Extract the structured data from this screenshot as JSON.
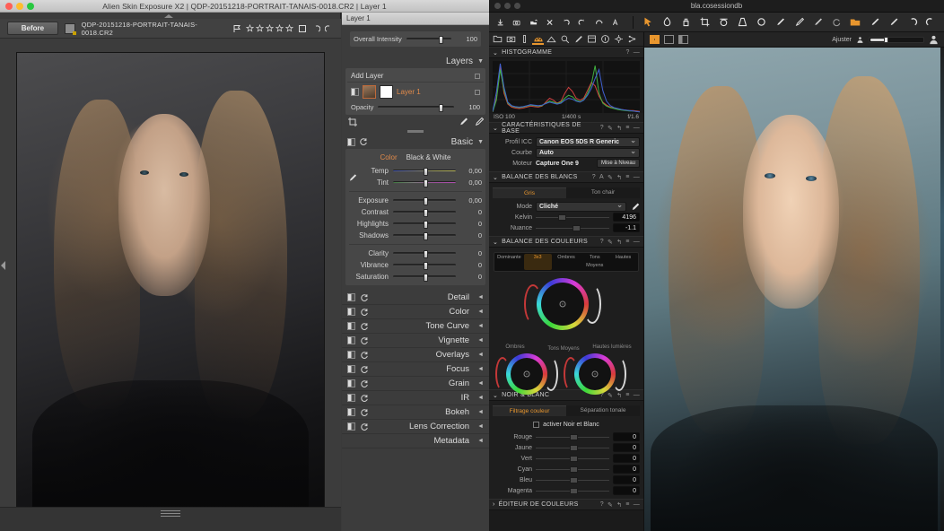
{
  "exposure": {
    "window_title": "Alien Skin Exposure X2 | QDP-20151218-PORTRAIT-TANAIS-0018.CR2 | Layer 1",
    "layer_tab": "Layer 1",
    "toolbar": {
      "before_label": "Before",
      "filename": "QDP-20151218-PORTRAIT-TANAIS-0018.CR2",
      "flag_icon": "flag-icon",
      "rating_stars": 5,
      "crop_icon": "square-icon",
      "undo_icon": "undo-icon",
      "redo_icon": "redo-icon"
    },
    "overall": {
      "label": "Overall Intensity",
      "value": "100"
    },
    "layers": {
      "title": "Layers",
      "add_layer": "Add Layer",
      "layer_name": "Layer 1",
      "opacity_label": "Opacity",
      "opacity_value": "100",
      "crop_tool_icon": "crop-icon",
      "brush_icon": "brush-icon",
      "eraser_icon": "eraser-icon"
    },
    "basic": {
      "title": "Basic",
      "mode_color": "Color",
      "mode_bw": "Black & White",
      "eyedropper_icon": "eyedropper-icon",
      "sliders": [
        {
          "label": "Temp",
          "value": "0,00",
          "knob": 50,
          "grad": "temp"
        },
        {
          "label": "Tint",
          "value": "0,00",
          "knob": 50,
          "grad": "tint"
        },
        {
          "label": "Exposure",
          "value": "0,00",
          "knob": 50,
          "grad": ""
        },
        {
          "label": "Contrast",
          "value": "0",
          "knob": 50,
          "grad": ""
        },
        {
          "label": "Highlights",
          "value": "0",
          "knob": 50,
          "grad": ""
        },
        {
          "label": "Shadows",
          "value": "0",
          "knob": 50,
          "grad": ""
        },
        {
          "label": "Clarity",
          "value": "0",
          "knob": 50,
          "grad": ""
        },
        {
          "label": "Vibrance",
          "value": "0",
          "knob": 50,
          "grad": ""
        },
        {
          "label": "Saturation",
          "value": "0",
          "knob": 50,
          "grad": ""
        }
      ]
    },
    "panels": [
      "Detail",
      "Color",
      "Tone Curve",
      "Vignette",
      "Overlays",
      "Focus",
      "Grain",
      "IR",
      "Bokeh",
      "Lens Correction",
      "Metadata"
    ]
  },
  "captureone": {
    "window_title": "bla.cosessiondb",
    "toolbar_icons": [
      "import-icon",
      "camera-icon",
      "export-icon",
      "delete-icon",
      "rotate-left-icon",
      "rotate-right-icon",
      "redo-icon",
      "annotate-icon"
    ],
    "tool_tabs": [
      "library-icon",
      "capture-icon",
      "lens-icon",
      "color-icon",
      "exposure-icon",
      "details-icon",
      "adjustments-icon",
      "metadata-icon",
      "output-icon",
      "settings-icon",
      "batch-icon"
    ],
    "active_tool_tab": 3,
    "histogram": {
      "title": "HISTOGRAMME",
      "iso": "ISO 100",
      "shutter": "1/400 s",
      "aperture": "f/1.6"
    },
    "base_characteristics": {
      "title": "CARACTÉRISTIQUES DE BASE",
      "rows": [
        {
          "label": "Profil ICC",
          "value": "Canon EOS 5DS R Generic"
        },
        {
          "label": "Courbe",
          "value": "Auto"
        }
      ],
      "engine_label": "Moteur",
      "engine_value": "Capture One 9",
      "upgrade_button": "Mise à Niveau"
    },
    "white_balance": {
      "title": "BALANCE DES BLANCS",
      "tabs": [
        "Gris",
        "Ton chair"
      ],
      "active_tab": 0,
      "mode_label": "Mode",
      "mode_value": "Cliché",
      "picker_icon": "eyedropper-icon",
      "sliders": [
        {
          "label": "Kelvin",
          "value": "4196",
          "knob": 32
        },
        {
          "label": "Nuance",
          "value": "-1.1",
          "knob": 52
        }
      ]
    },
    "color_balance": {
      "title": "BALANCE DES COULEURS",
      "tabs": [
        "Dominante",
        "3x3",
        "Ombres",
        "Tons Moyens",
        "Hautes"
      ],
      "active_tab": 1,
      "wheel_labels": [
        "Ombres",
        "Tons Moyens",
        "Hautes lumières"
      ]
    },
    "black_white": {
      "title": "NOIR & BLANC",
      "tabs": [
        "Filtrage couleur",
        "Séparation tonale"
      ],
      "active_tab": 0,
      "checkbox_label": "activer Noir et Blanc",
      "checked": false,
      "sliders": [
        {
          "label": "Rouge",
          "value": "0"
        },
        {
          "label": "Jaune",
          "value": "0"
        },
        {
          "label": "Vert",
          "value": "0"
        },
        {
          "label": "Cyan",
          "value": "0"
        },
        {
          "label": "Bleu",
          "value": "0"
        },
        {
          "label": "Magenta",
          "value": "0"
        }
      ]
    },
    "color_editor": {
      "title": "ÉDITEUR DE COULEURS"
    },
    "viewer": {
      "grid_icon": "grid-view-icon",
      "single_icon": "single-view-icon",
      "split_icon": "split-view-icon",
      "fit_label": "Ajuster",
      "small_icon": "small-thumb-icon",
      "large_icon": "large-thumb-icon"
    }
  },
  "colors": {
    "accent_orange": "#e8962e",
    "layer_orange": "#e08a4a",
    "panel_gray": "#3c3c3c",
    "c1_dark": "#1e1e1e"
  },
  "chart_data": {
    "type": "area",
    "title": "HISTOGRAMME",
    "xlabel": "",
    "ylabel": "",
    "series": [
      {
        "name": "red",
        "values": [
          2,
          30,
          95,
          40,
          18,
          12,
          10,
          9,
          10,
          12,
          14,
          13,
          12,
          14,
          22,
          30,
          26,
          20,
          24,
          40,
          52,
          44,
          30,
          26,
          30,
          46,
          62,
          55,
          34,
          22,
          16,
          12,
          10,
          8,
          7,
          6,
          5,
          5,
          4,
          3
        ]
      },
      {
        "name": "green",
        "values": [
          2,
          26,
          88,
          46,
          20,
          14,
          12,
          11,
          12,
          14,
          16,
          15,
          14,
          15,
          20,
          24,
          22,
          19,
          22,
          30,
          36,
          33,
          26,
          23,
          27,
          40,
          58,
          96,
          40,
          20,
          14,
          11,
          9,
          7,
          6,
          5,
          4,
          4,
          3,
          2
        ]
      },
      {
        "name": "blue",
        "values": [
          3,
          42,
          100,
          52,
          22,
          15,
          13,
          12,
          13,
          15,
          17,
          16,
          15,
          16,
          19,
          22,
          20,
          18,
          20,
          26,
          30,
          28,
          24,
          22,
          26,
          36,
          50,
          70,
          88,
          46,
          24,
          15,
          11,
          9,
          7,
          6,
          5,
          4,
          3,
          2
        ]
      }
    ],
    "ylim": [
      0,
      100
    ]
  }
}
